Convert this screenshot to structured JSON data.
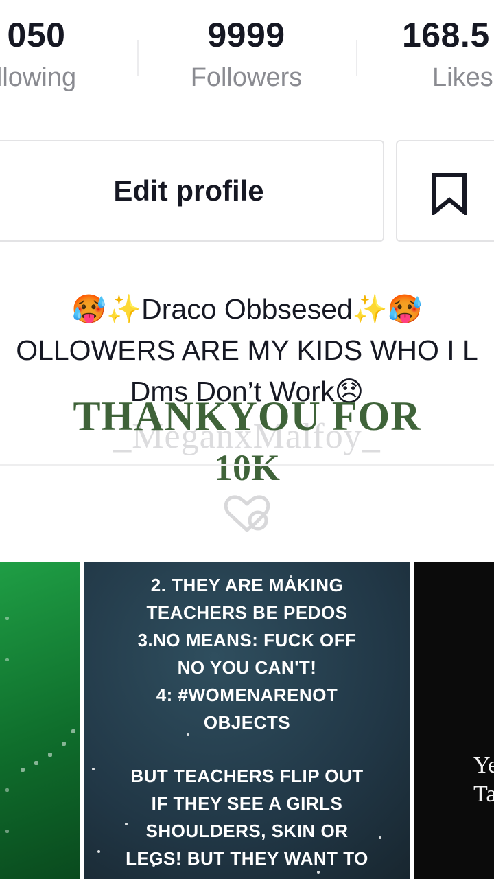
{
  "stats": [
    {
      "value": "050",
      "label": "llowing"
    },
    {
      "value": "9999",
      "label": "Followers"
    },
    {
      "value": "168.5",
      "label": "Likes"
    }
  ],
  "actions": {
    "edit_profile_label": "Edit profile",
    "bookmark_icon": "bookmark-icon"
  },
  "bio": {
    "line1": "🥵✨Draco Obbsesed✨🥵",
    "line2": "OLLOWERS ARE MY KIDS WHO I L",
    "line3": "Dms Don’t Work😞"
  },
  "overlay": {
    "thanks_text": "THANKYOU FOR",
    "milestone_text": "10K",
    "username": "_MeganxMalfoy_"
  },
  "liked_icon": "heart-slash-icon",
  "video_tiles": [
    {
      "id": "green"
    },
    {
      "lines": [
        "2. THEY ARE MAKING",
        "TEACHERS BE PEDOS",
        "3.NO MEANS: FUCK OFF",
        "NO YOU CAN'T!",
        "4: #WOMENARENOT",
        "OBJECTS",
        "",
        "BUT TEACHERS FLIP OUT",
        "IF THEY SEE A GIRLS",
        "SHOULDERS, SKIN OR",
        "LEGS! BUT THEY WANT TO"
      ]
    },
    {
      "lines": [
        "Ye",
        "Ta"
      ]
    }
  ]
}
